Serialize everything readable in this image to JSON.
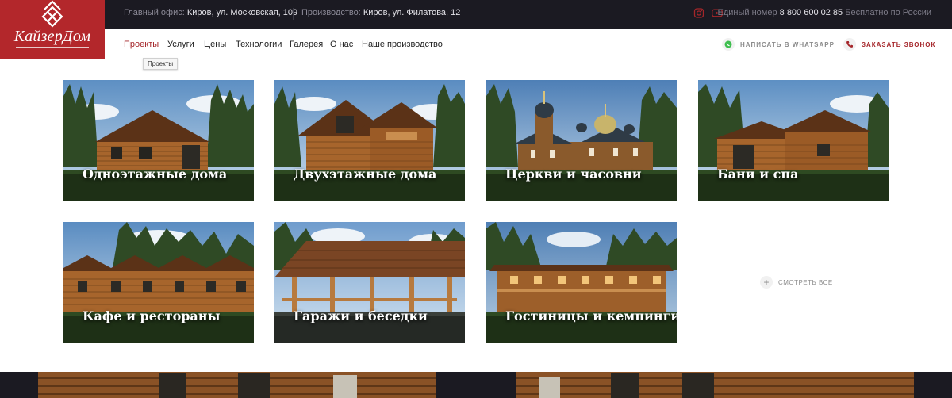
{
  "brand": {
    "name": "КайзерДом",
    "color": "#b3272b",
    "emblem_icon": "diamond-lattice-logo-icon"
  },
  "topbar": {
    "office_label": "Главный офис:",
    "office_value": "Киров, ул. Московская, 109",
    "production_label": "Производство:",
    "production_value": "Киров, ул. Филатова, 12",
    "social_icons": [
      "instagram-icon",
      "youtube-icon"
    ],
    "phone_label": "Единый номер",
    "phone_number": "8 800 600 02 85",
    "phone_note": "Бесплатно по России",
    "background": "#1b1a22"
  },
  "nav": {
    "items": [
      "Проекты",
      "Услуги",
      "Цены",
      "Технологии",
      "Галерея",
      "О нас",
      "Наше производство"
    ],
    "active_index": 0,
    "tooltip": "Проекты",
    "whatsapp_label": "НАПИСАТЬ В WHATSAPP",
    "whatsapp_icon": "whatsapp-icon",
    "call_label": "ЗАКАЗАТЬ ЗВОНОК",
    "call_icon": "phone-icon",
    "accent": "#a5262a"
  },
  "categories": [
    {
      "title": "Одноэтажные дома",
      "image": "one-story-log-house"
    },
    {
      "title": "Двухэтажные дома",
      "image": "two-story-log-house"
    },
    {
      "title": "Церкви и часовни",
      "image": "wooden-church"
    },
    {
      "title": "Бани и спа",
      "image": "log-bathhouse"
    },
    {
      "title": "Кафе и рестораны",
      "image": "log-restaurant"
    },
    {
      "title": "Гаражи и беседки",
      "image": "log-gazebo"
    },
    {
      "title": "Гостиницы и кемпинги",
      "image": "log-hotel"
    }
  ],
  "see_all": {
    "label": "СМОТРЕТЬ ВСЕ",
    "icon": "plus-icon"
  }
}
